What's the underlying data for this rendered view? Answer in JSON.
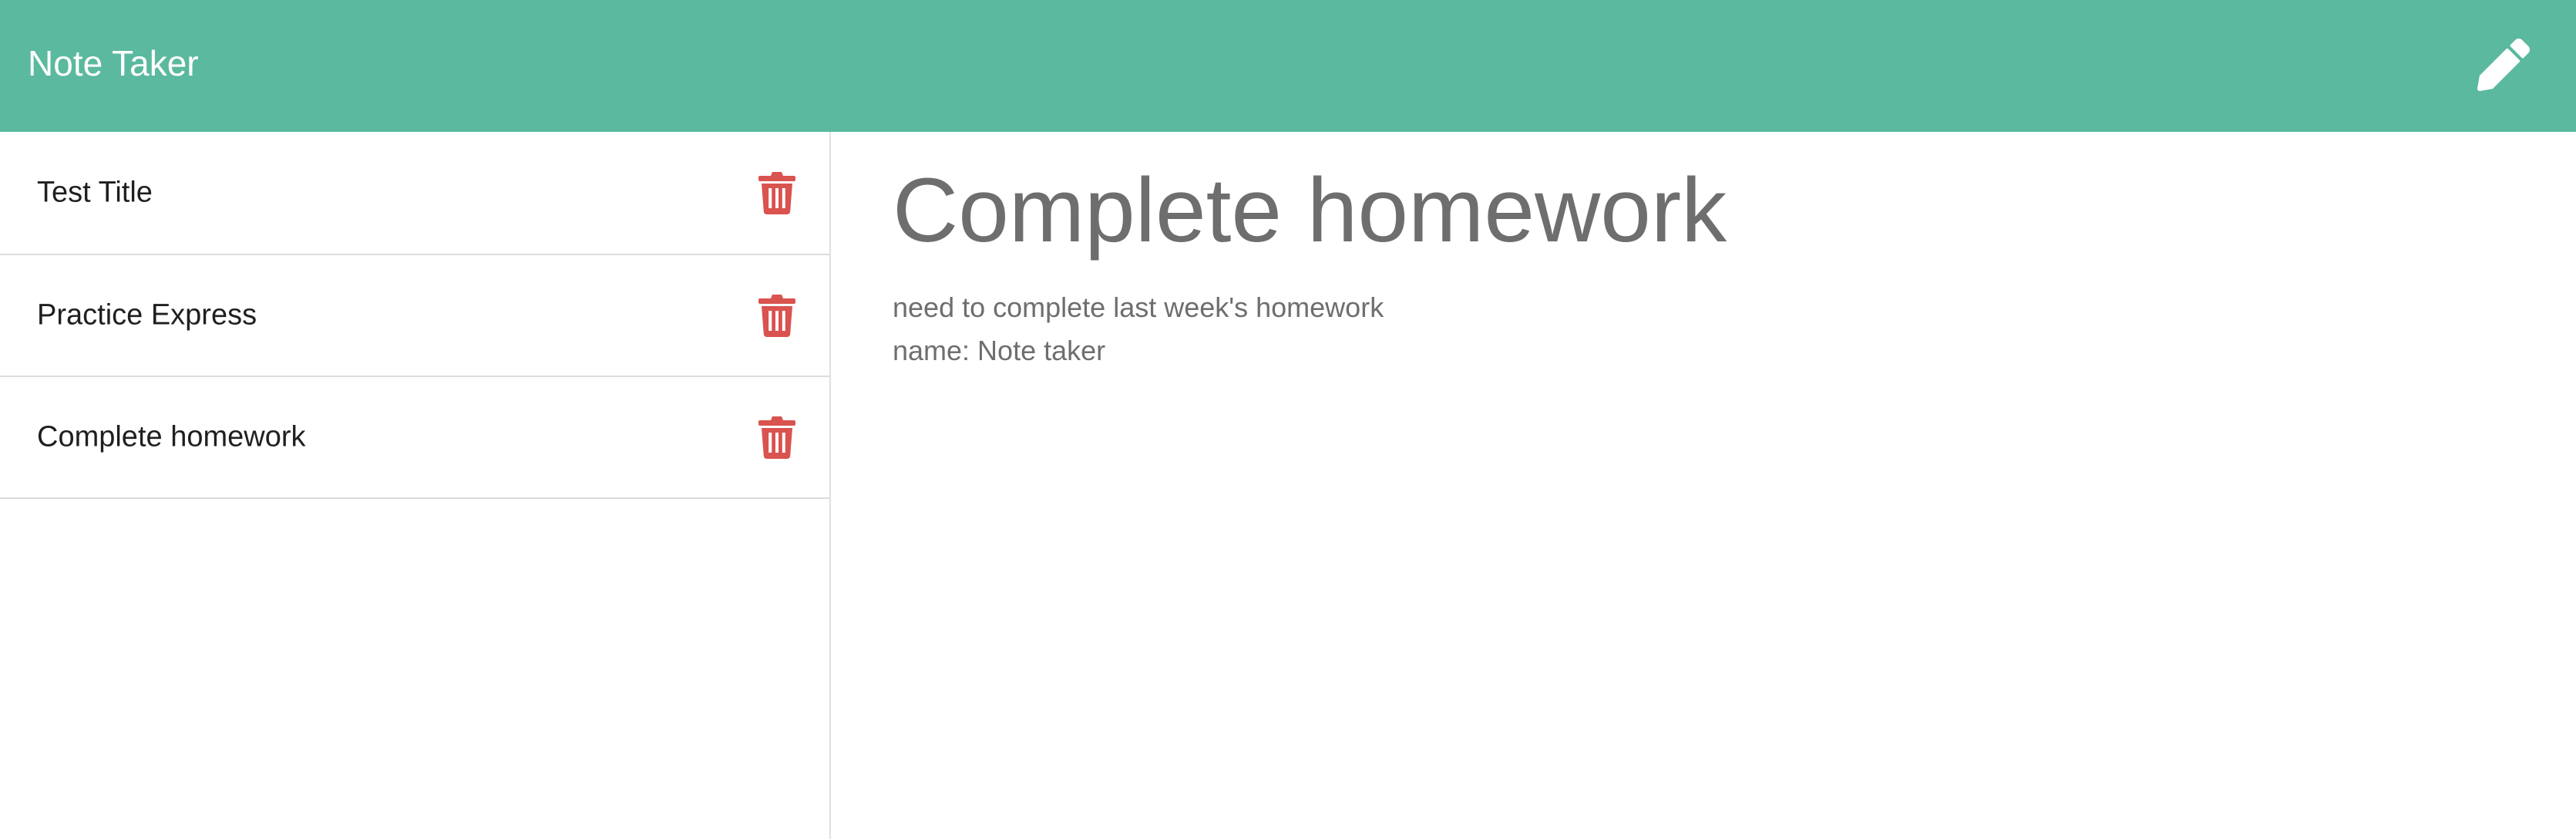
{
  "navbar": {
    "brand": "Note Taker",
    "new_note_icon": "pencil-icon",
    "background": "#5ab99e"
  },
  "sidebar": {
    "notes": [
      {
        "title": "Test Title",
        "icon": "trash-icon"
      },
      {
        "title": "Practice Express",
        "icon": "trash-icon"
      },
      {
        "title": "Complete homework",
        "icon": "trash-icon"
      }
    ],
    "delete_color": "#d9534f"
  },
  "main": {
    "title": "Complete homework",
    "body_lines": [
      "need to complete last week's homework",
      "name: Note taker"
    ]
  }
}
